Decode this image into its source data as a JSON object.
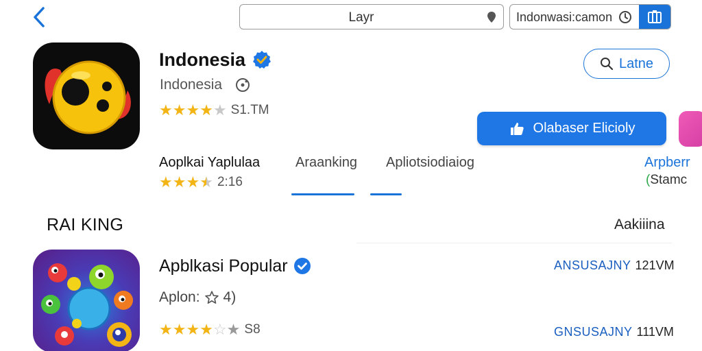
{
  "topbar": {
    "search_value": "Layr",
    "filter_value": "Indonwasi:camon"
  },
  "app": {
    "title": "Indonesia",
    "subtitle": "Indonesia",
    "rating_stars": 4,
    "rating_text": "S1.TM",
    "secondary_button": "Latne",
    "primary_button": "Olabaser Elicioly"
  },
  "tabs": {
    "items": [
      {
        "label": "Aoplkai Yaplulaa"
      },
      {
        "label": "Araanking"
      },
      {
        "label": "Apliotsiodiaiog"
      },
      {
        "label": "Arpberr"
      }
    ],
    "rating_stars": 3.5,
    "rating_text": "2:16",
    "stamo_label": "Stamc"
  },
  "section": {
    "title": "RAI KING",
    "right_label": "Aakiiina"
  },
  "list_item": {
    "title": "Apblkasi Popular",
    "meta_label": "Aplon:",
    "meta_value": "4)",
    "rating_stars": 4,
    "rating_text": "S8",
    "stats": [
      {
        "key": "ANSUSAJNY",
        "value": "121VM"
      },
      {
        "key": "GNSUSAJNY",
        "value": "111VM"
      }
    ]
  },
  "colors": {
    "accent": "#1a73d9",
    "star": "#f3b416",
    "primary_button": "#1f77e5"
  }
}
